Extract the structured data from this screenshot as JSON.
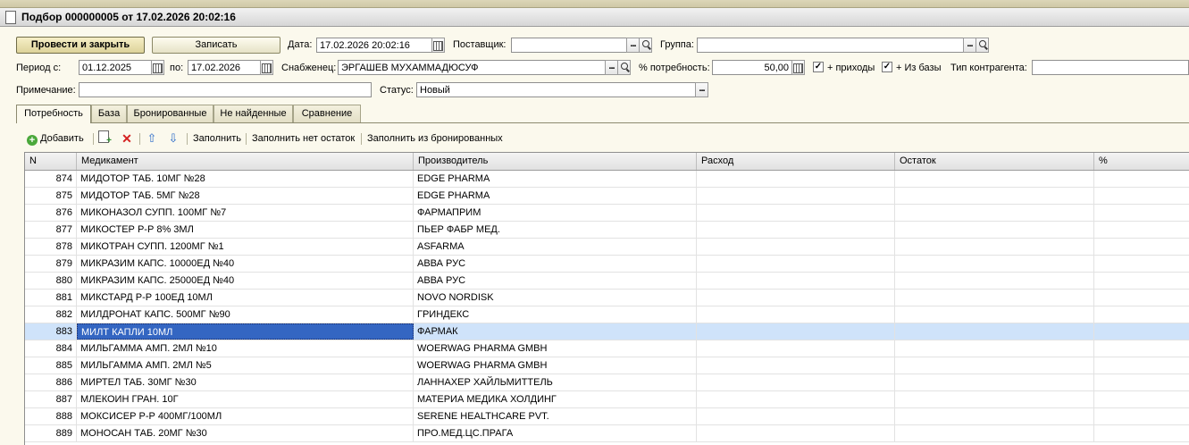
{
  "window": {
    "title": "Подбор 000000005 от 17.02.2026 20:02:16"
  },
  "toolbar": {
    "post_close_label": "Провести и закрыть",
    "save_label": "Записать"
  },
  "form": {
    "date_label": "Дата:",
    "date_value": "17.02.2026 20:02:16",
    "supplier_label": "Поставщик:",
    "supplier_value": "",
    "group_label": "Группа:",
    "group_value": "",
    "period_label": "Период с:",
    "period_from": "01.12.2025",
    "period_to_label": "по:",
    "period_to": "17.02.2026",
    "buyer_label": "Снабженец:",
    "buyer_value": "ЭРГАШЕВ МУХАММАДЮСУФ",
    "need_label": "% потребность:",
    "need_value": "50,00",
    "plus_income_label": "+ приходы",
    "plus_income_checked": true,
    "from_base_label": "+ Из базы",
    "from_base_checked": true,
    "contractor_type_label": "Тип контрагента:",
    "contractor_type_value": "",
    "note_label": "Примечание:",
    "note_value": "",
    "status_label": "Статус:",
    "status_value": "Новый"
  },
  "tabs": [
    {
      "label": "Потребность",
      "active": true
    },
    {
      "label": "База",
      "active": false
    },
    {
      "label": "Бронированные",
      "active": false
    },
    {
      "label": "Не найденные",
      "active": false
    },
    {
      "label": "Сравнение",
      "active": false
    }
  ],
  "grid_toolbar": {
    "add_label": "Добавить",
    "fill_label": "Заполнить",
    "fill_no_stock_label": "Заполнить нет остаток",
    "fill_reserved_label": "Заполнить из бронированных"
  },
  "table": {
    "columns": [
      "N",
      "Медикамент",
      "Производитель",
      "Расход",
      "Остаток",
      "%"
    ],
    "rows": [
      {
        "n": "874",
        "med": "МИДОТОР ТАБ. 10МГ №28",
        "mfr": "EDGE PHARMA"
      },
      {
        "n": "875",
        "med": "МИДОТОР ТАБ. 5МГ №28",
        "mfr": "EDGE PHARMA"
      },
      {
        "n": "876",
        "med": "МИКОНАЗОЛ СУПП. 100МГ №7",
        "mfr": "ФАРМАПРИМ"
      },
      {
        "n": "877",
        "med": "МИКОСТЕР Р-Р 8% 3МЛ",
        "mfr": "ПЬЕР ФАБР МЕД."
      },
      {
        "n": "878",
        "med": "МИКОТРАН СУПП. 1200МГ №1",
        "mfr": "ASFARMA"
      },
      {
        "n": "879",
        "med": "МИКРАЗИМ КАПС. 10000ЕД №40",
        "mfr": "АВВА РУС"
      },
      {
        "n": "880",
        "med": "МИКРАЗИМ КАПС. 25000ЕД №40",
        "mfr": "АВВА РУС"
      },
      {
        "n": "881",
        "med": "МИКСТАРД Р-Р 100ЕД 10МЛ",
        "mfr": "NOVO NORDISK"
      },
      {
        "n": "882",
        "med": "МИЛДРОНАТ КАПС. 500МГ №90",
        "mfr": "ГРИНДЕКС"
      },
      {
        "n": "883",
        "med": "МИЛТ КАПЛИ 10МЛ",
        "mfr": "ФАРМАК"
      },
      {
        "n": "884",
        "med": "МИЛЬГАММА АМП. 2МЛ №10",
        "mfr": "WOERWAG PHARMA GMBH"
      },
      {
        "n": "885",
        "med": "МИЛЬГАММА АМП. 2МЛ №5",
        "mfr": "WOERWAG PHARMA GMBH"
      },
      {
        "n": "886",
        "med": "МИРТЕЛ ТАБ. 30МГ №30",
        "mfr": "ЛАННАХЕР ХАЙЛЬМИТТЕЛЬ"
      },
      {
        "n": "887",
        "med": "МЛЕКОИН ГРАН. 10Г",
        "mfr": "МАТЕРИА МЕДИКА ХОЛДИНГ"
      },
      {
        "n": "888",
        "med": "МОКСИСЕР Р-Р 400МГ/100МЛ",
        "mfr": "SERENE HEALTHCARE PVT."
      },
      {
        "n": "889",
        "med": "МОНОСАН ТАБ. 20МГ №30",
        "mfr": "ПРО.МЕД.ЦС.ПРАГА"
      }
    ]
  },
  "colors": {
    "selected_row": "#cfe3fa",
    "cursor_cell": "#3466c2",
    "background": "#fbf9ed"
  }
}
